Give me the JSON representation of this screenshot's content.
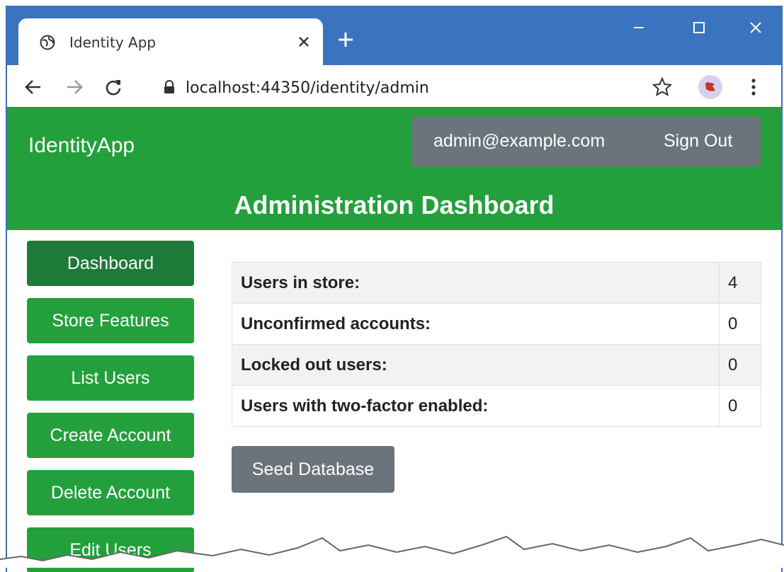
{
  "browser": {
    "tab_title": "Identity App",
    "url": "localhost:44350/identity/admin"
  },
  "header": {
    "brand": "IdentityApp",
    "user_email": "admin@example.com",
    "sign_out_label": "Sign Out",
    "page_title": "Administration Dashboard"
  },
  "sidebar": {
    "items": [
      {
        "label": "Dashboard",
        "active": true
      },
      {
        "label": "Store Features",
        "active": false
      },
      {
        "label": "List Users",
        "active": false
      },
      {
        "label": "Create Account",
        "active": false
      },
      {
        "label": "Delete Account",
        "active": false
      },
      {
        "label": "Edit Users",
        "active": false
      }
    ]
  },
  "stats": {
    "rows": [
      {
        "label": "Users in store:",
        "value": "4"
      },
      {
        "label": "Unconfirmed accounts:",
        "value": "0"
      },
      {
        "label": "Locked out users:",
        "value": "0"
      },
      {
        "label": "Users with two-factor enabled:",
        "value": "0"
      }
    ]
  },
  "actions": {
    "seed_label": "Seed Database"
  },
  "icons": {
    "tab": "globe-icon",
    "tab_close": "close-icon",
    "new_tab": "plus-icon",
    "back": "back-arrow-icon",
    "forward": "forward-arrow-icon",
    "reload": "reload-icon",
    "lock": "lock-icon",
    "bookmark": "star-icon",
    "menu": "kebab-menu-icon"
  },
  "colors": {
    "chrome_blue": "#3a73bf",
    "header_green": "#23a03c",
    "active_green": "#1e7a37",
    "secondary_gray": "#6b737b"
  }
}
